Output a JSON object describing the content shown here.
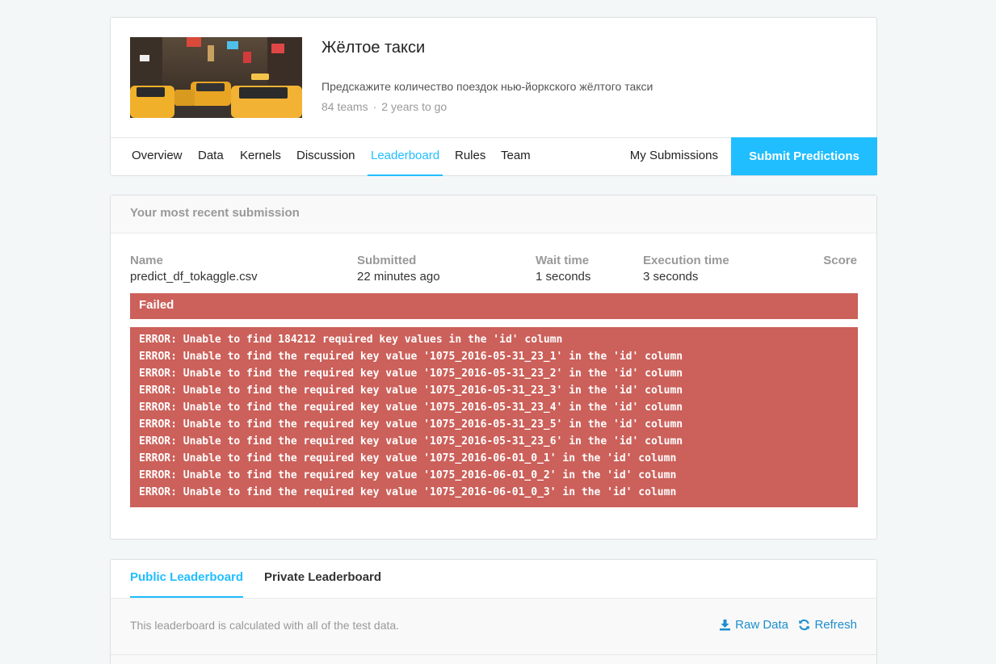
{
  "competition": {
    "title": "Жёлтое такси",
    "description": "Предскажите количество поездок нью-йоркского жёлтого такси",
    "teams": "84 teams",
    "separator": "·",
    "deadline": "2 years to go",
    "image_icon": "taxi-street-photo"
  },
  "tabs": [
    {
      "label": "Overview"
    },
    {
      "label": "Data"
    },
    {
      "label": "Kernels"
    },
    {
      "label": "Discussion"
    },
    {
      "label": "Leaderboard",
      "active": true
    },
    {
      "label": "Rules"
    },
    {
      "label": "Team"
    }
  ],
  "actions": {
    "my_submissions": "My Submissions",
    "submit_predictions": "Submit Predictions"
  },
  "submission": {
    "header": "Your most recent submission",
    "columns": {
      "name_label": "Name",
      "submitted_label": "Submitted",
      "wait_label": "Wait time",
      "exec_label": "Execution time",
      "score_label": "Score"
    },
    "values": {
      "name": "predict_df_tokaggle.csv",
      "submitted": "22 minutes ago",
      "wait": "1 seconds",
      "exec": "3 seconds",
      "score": ""
    },
    "status": "Failed",
    "errors": [
      "ERROR: Unable to find 184212 required key values in the 'id' column",
      "ERROR: Unable to find the required key value '1075_2016-05-31_23_1' in the 'id' column",
      "ERROR: Unable to find the required key value '1075_2016-05-31_23_2' in the 'id' column",
      "ERROR: Unable to find the required key value '1075_2016-05-31_23_3' in the 'id' column",
      "ERROR: Unable to find the required key value '1075_2016-05-31_23_4' in the 'id' column",
      "ERROR: Unable to find the required key value '1075_2016-05-31_23_5' in the 'id' column",
      "ERROR: Unable to find the required key value '1075_2016-05-31_23_6' in the 'id' column",
      "ERROR: Unable to find the required key value '1075_2016-06-01_0_1' in the 'id' column",
      "ERROR: Unable to find the required key value '1075_2016-06-01_0_2' in the 'id' column",
      "ERROR: Unable to find the required key value '1075_2016-06-01_0_3' in the 'id' column"
    ]
  },
  "leaderboard": {
    "tabs": [
      {
        "label": "Public Leaderboard",
        "active": true
      },
      {
        "label": "Private Leaderboard"
      }
    ],
    "note": "This leaderboard is calculated with all of the test data.",
    "raw_data": "Raw Data",
    "refresh": "Refresh"
  },
  "colors": {
    "accent": "#20beff",
    "error": "#cc605a",
    "link": "#1c8ecf"
  }
}
